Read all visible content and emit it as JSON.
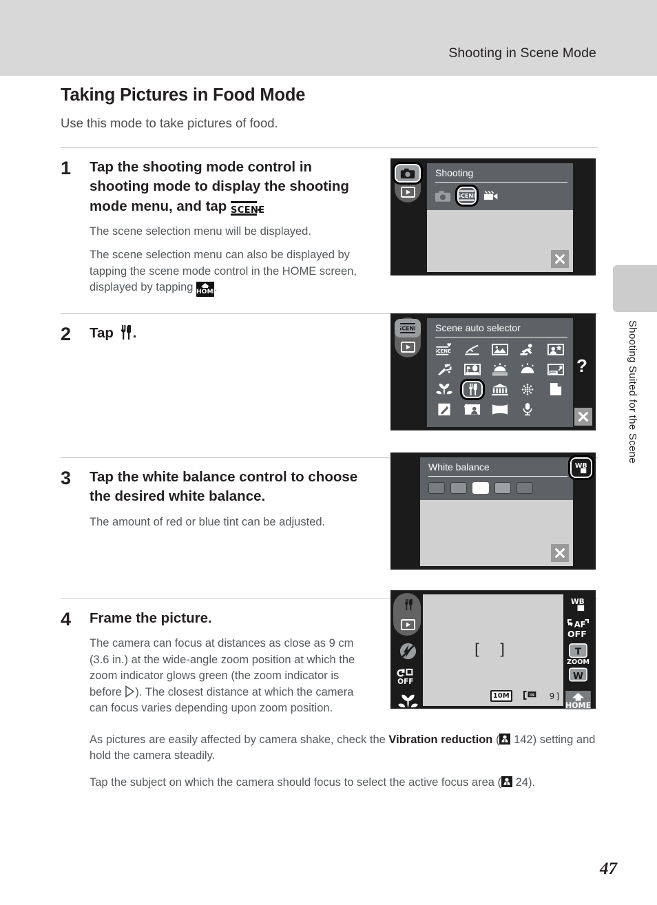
{
  "header": {
    "running_head": "Shooting in Scene Mode"
  },
  "side_tab": {
    "vertical_label": "Shooting Suited for the Scene"
  },
  "page": {
    "heading": "Taking Pictures in Food Mode",
    "intro": "Use this mode to take pictures of food.",
    "number": "47"
  },
  "steps": [
    {
      "number": "1",
      "lead_before": "Tap the shooting mode control in shooting mode to display the shooting mode menu, and tap ",
      "lead_icon": "scene-icon",
      "lead_after": ".",
      "notes": [
        "The scene selection menu will be displayed.",
        "The scene selection menu can also be displayed by tapping the scene mode control in the HOME screen, displayed by tapping "
      ],
      "note2_icon": "home-icon",
      "note2_after": "."
    },
    {
      "number": "2",
      "lead_before": "Tap ",
      "lead_icon": "food-fork-knife-icon",
      "lead_after": ".",
      "notes": []
    },
    {
      "number": "3",
      "lead_before": "Tap the white balance control to choose the desired white balance.",
      "notes": [
        "The amount of red or blue tint can be adjusted."
      ]
    },
    {
      "number": "4",
      "lead_before": "Frame the picture.",
      "notes": [
        "The camera can focus at distances as close as 9 cm (3.6 in.) at the wide-angle zoom position at which the zoom indicator glows green (the zoom indicator is before ",
        "). The closest distance at which the camera can focus varies depending upon zoom position."
      ],
      "note_icon": "triangle-right-icon",
      "extra_paragraphs": [
        {
          "pre": "As pictures are easily affected by camera shake, check the ",
          "bold": "Vibration reduction",
          "mid": " (",
          "ref_icon": "book-ref-icon",
          "ref": " 142",
          "post": ") setting and hold the camera steadily."
        },
        {
          "pre": "Tap the subject on which the camera should focus to select the active focus area (",
          "ref_icon": "book-ref-icon",
          "ref": " 24",
          "post": ")."
        }
      ]
    }
  ],
  "screens": {
    "shooting_menu": {
      "title": "Shooting",
      "left_rail": [
        "camera-mode-icon",
        "playback-icon"
      ],
      "options": [
        "camera-auto-icon",
        "scene-icon",
        "movie-icon"
      ],
      "selected_option_index": 1,
      "highlighted_rail_index": 0,
      "close_label": "✕",
      "panel_color": "#5e6266",
      "frame_color": "#1b1b1b",
      "screen_bg": "#d0d0d0"
    },
    "scene_selector": {
      "title": "Scene auto selector",
      "left_rail": [
        "scene-mode-icon",
        "playback-icon"
      ],
      "help_label": "?",
      "close_label": "✕",
      "selected_index": 11,
      "icons": [
        "scene-auto-selector-icon",
        "portrait-icon",
        "landscape-icon",
        "sports-icon",
        "night-portrait-icon",
        "party-indoor-icon",
        "beach-snow-icon",
        "sunset-icon",
        "dusk-dawn-icon",
        "night-landscape-icon",
        "close-up-icon",
        "food-icon",
        "museum-icon",
        "fireworks-icon",
        "copy-icon",
        "draw-icon",
        "backlight-icon",
        "panorama-icon",
        "voice-recording-icon"
      ]
    },
    "white_balance": {
      "title": "White balance",
      "badge_label": "WB",
      "close_label": "✕",
      "swatches": [
        "#7a7d80",
        "#8f9295",
        "#ffffff",
        "#9ea1a4",
        "#74777a"
      ],
      "selected_swatch_index": 2
    },
    "framing": {
      "left_icons": [
        "food-mode-icon",
        "playback-icon",
        "flash-off-icon",
        "self-timer-off-icon",
        "macro-icon"
      ],
      "right_icons": [
        "white-balance-icon",
        "af-off-icon",
        "zoom-tele-icon",
        "zoom-wide-icon",
        "home-icon"
      ],
      "zoom_label": "ZOOM",
      "tele_label": "T",
      "wide_label": "W",
      "home_label": "HOME",
      "af_label": "AF",
      "off_label": "OFF",
      "wb_label": "WB",
      "focus_brackets": "[  ]",
      "image_size_badge": "10M",
      "memory_badge": "IN",
      "shots_remaining": "9"
    }
  }
}
